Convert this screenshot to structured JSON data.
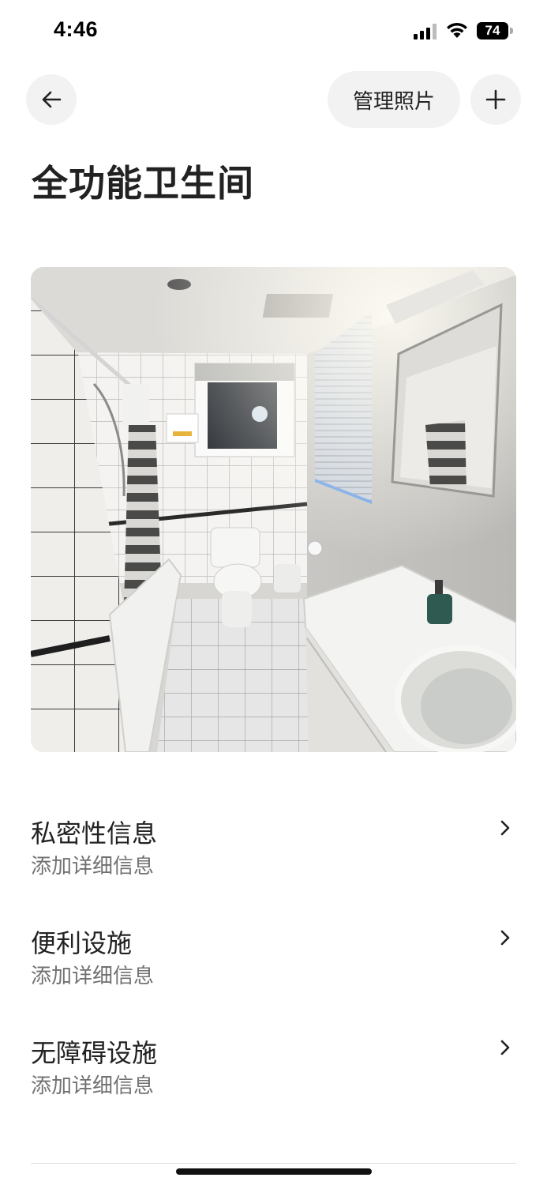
{
  "status_bar": {
    "time": "4:46",
    "battery_level": "74"
  },
  "header": {
    "back_icon": "arrow-left-icon",
    "manage_photos_label": "管理照片",
    "add_icon": "plus-icon"
  },
  "page": {
    "title": "全功能卫生间"
  },
  "photo": {
    "subject": "bathroom"
  },
  "sections": [
    {
      "title": "私密性信息",
      "subtitle": "添加详细信息"
    },
    {
      "title": "便利设施",
      "subtitle": "添加详细信息"
    },
    {
      "title": "无障碍设施",
      "subtitle": "添加详细信息"
    }
  ],
  "colors": {
    "text_primary": "#222222",
    "text_secondary": "#717171",
    "button_bg": "#f2f2f2"
  }
}
